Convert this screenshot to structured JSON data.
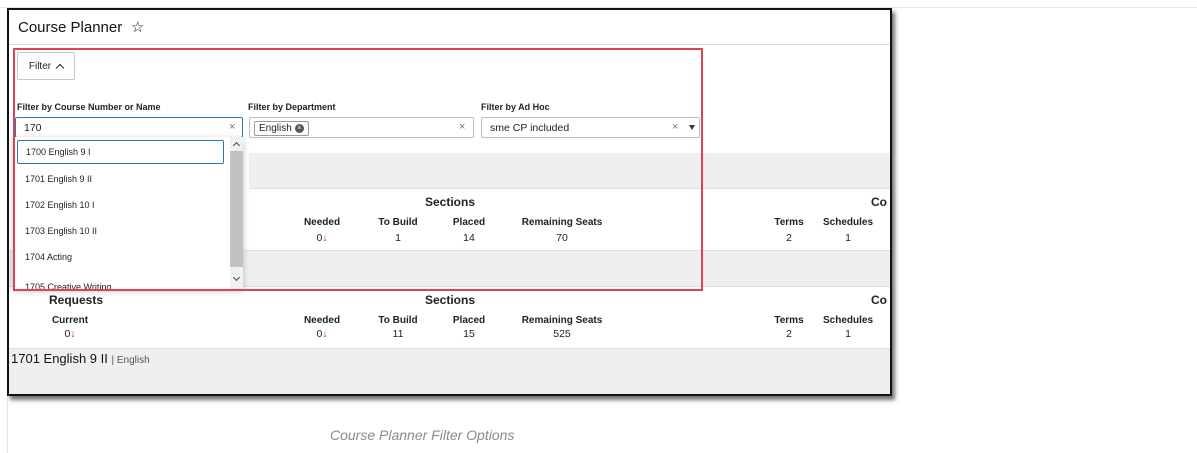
{
  "page": {
    "title": "Course Planner",
    "filter_button": "Filter",
    "filters": {
      "course_label": "Filter by Course Number or Name",
      "course_value": "170",
      "department_label": "Filter by Department",
      "department_chip": "English",
      "adhoc_label": "Filter by Ad Hoc",
      "adhoc_value": "sme CP included",
      "clear": "×"
    },
    "dropdown_options": [
      "1700 English 9 I",
      "1701 English 9 II",
      "1702 English 10 I",
      "1703 English 10 II",
      "1704 Acting",
      "1705 Creative Writing"
    ],
    "section_headers": {
      "requests": "Requests",
      "sections": "Sections",
      "co": "Co"
    },
    "columns": {
      "current": "Current",
      "needed": "Needed",
      "to_build": "To Build",
      "placed": "Placed",
      "remaining_seats": "Remaining Seats",
      "terms": "Terms",
      "schedules": "Schedules"
    },
    "row1": {
      "needed": "0",
      "to_build": "1",
      "placed": "14",
      "remaining_seats": "70",
      "terms": "2",
      "schedules": "1"
    },
    "row2": {
      "current": "0",
      "needed": "0",
      "to_build": "11",
      "placed": "15",
      "remaining_seats": "525",
      "terms": "2",
      "schedules": "1"
    },
    "down_arrow": "↓",
    "course": {
      "name": "1701 English 9 II",
      "dept": "| English"
    },
    "caption": "Course Planner Filter Options"
  }
}
